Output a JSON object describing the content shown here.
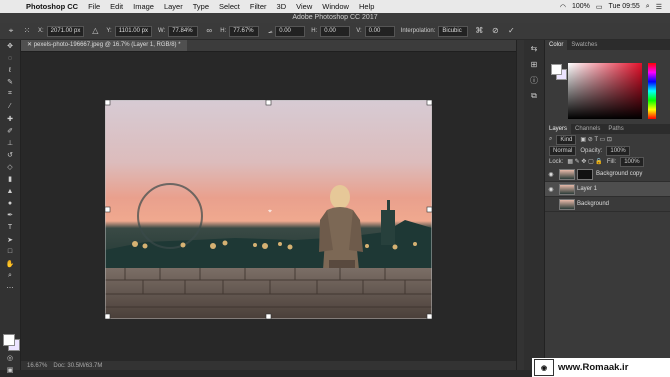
{
  "menubar": {
    "app": "Photoshop CC",
    "items": [
      "File",
      "Edit",
      "Image",
      "Layer",
      "Type",
      "Select",
      "Filter",
      "3D",
      "View",
      "Window",
      "Help"
    ],
    "battery": "100%",
    "clock": "Tue 09:55"
  },
  "window_title": "Adobe Photoshop CC 2017",
  "options": {
    "x_label": "X:",
    "x_value": "2071.00 px",
    "y_label": "Y:",
    "y_value": "1101.00 px",
    "w_label": "W:",
    "w_value": "77.84%",
    "h_label": "H:",
    "h_value": "77.67%",
    "angle_value": "0.00",
    "hskew_label": "H:",
    "hskew_value": "0.00",
    "vskew_label": "V:",
    "vskew_value": "0.00",
    "interp_label": "Interpolation:",
    "interp_value": "Bicubic"
  },
  "document_tab": "pexels-photo-196667.jpeg @ 16.7% (Layer 1, RGB/8) *",
  "status": {
    "zoom": "16.67%",
    "doc": "Doc: 30.5M/63.7M"
  },
  "color_panel": {
    "tabs": [
      "Color",
      "Swatches"
    ]
  },
  "layers_panel": {
    "tabs": [
      "Layers",
      "Channels",
      "Paths"
    ],
    "kind_label": "Kind",
    "blend_mode": "Normal",
    "opacity_label": "Opacity:",
    "opacity_value": "100%",
    "lock_label": "Lock:",
    "fill_label": "Fill:",
    "fill_value": "100%",
    "layers": [
      {
        "name": "Background copy"
      },
      {
        "name": "Layer 1"
      },
      {
        "name": "Background"
      }
    ]
  },
  "watermark": "www.Romaak.ir",
  "colors": {
    "sky_top": "#d9cfd6",
    "sky_glow": "#e79c8a",
    "ground": "#1c3734"
  }
}
